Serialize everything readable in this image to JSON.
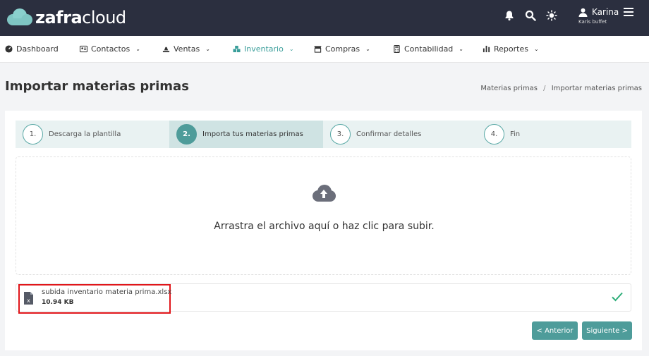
{
  "brand": {
    "logo_prefix": "zafra",
    "logo_suffix": "cloud"
  },
  "header": {
    "user_name": "Karina",
    "user_sub": "Karis buffet",
    "icons": [
      "bell-icon",
      "search-icon",
      "sun-icon",
      "user-icon",
      "menu-icon"
    ]
  },
  "nav": {
    "items": [
      {
        "label": "Dashboard",
        "icon": "dashboard-icon",
        "dropdown": false
      },
      {
        "label": "Contactos",
        "icon": "contacts-icon",
        "dropdown": true
      },
      {
        "label": "Ventas",
        "icon": "sales-icon",
        "dropdown": true
      },
      {
        "label": "Inventario",
        "icon": "inventory-icon",
        "dropdown": true,
        "active": true
      },
      {
        "label": "Compras",
        "icon": "store-icon",
        "dropdown": true
      },
      {
        "label": "Contabilidad",
        "icon": "calculator-icon",
        "dropdown": true
      },
      {
        "label": "Reportes",
        "icon": "bar-chart-icon",
        "dropdown": true
      }
    ]
  },
  "page": {
    "title": "Importar materias primas",
    "breadcrumb": [
      "Materias primas",
      "Importar materias primas"
    ]
  },
  "steps": [
    {
      "num": "1.",
      "label": "Descarga la plantilla",
      "active": false
    },
    {
      "num": "2.",
      "label": "Importa tus materias primas",
      "active": true
    },
    {
      "num": "3.",
      "label": "Confirmar detalles",
      "active": false
    },
    {
      "num": "4.",
      "label": "Fin",
      "active": false
    }
  ],
  "dropzone": {
    "text": "Arrastra el archivo aquí o haz clic para subir."
  },
  "file": {
    "name": "subida inventario materia prima.xlsx",
    "size": "10.94 KB"
  },
  "buttons": {
    "prev": "< Anterior",
    "next": "Siguiente >"
  },
  "colors": {
    "topbar": "#2b2f3f",
    "accent": "#4e9c9a",
    "highlight": "#e0161a",
    "success": "#2fae7a"
  }
}
